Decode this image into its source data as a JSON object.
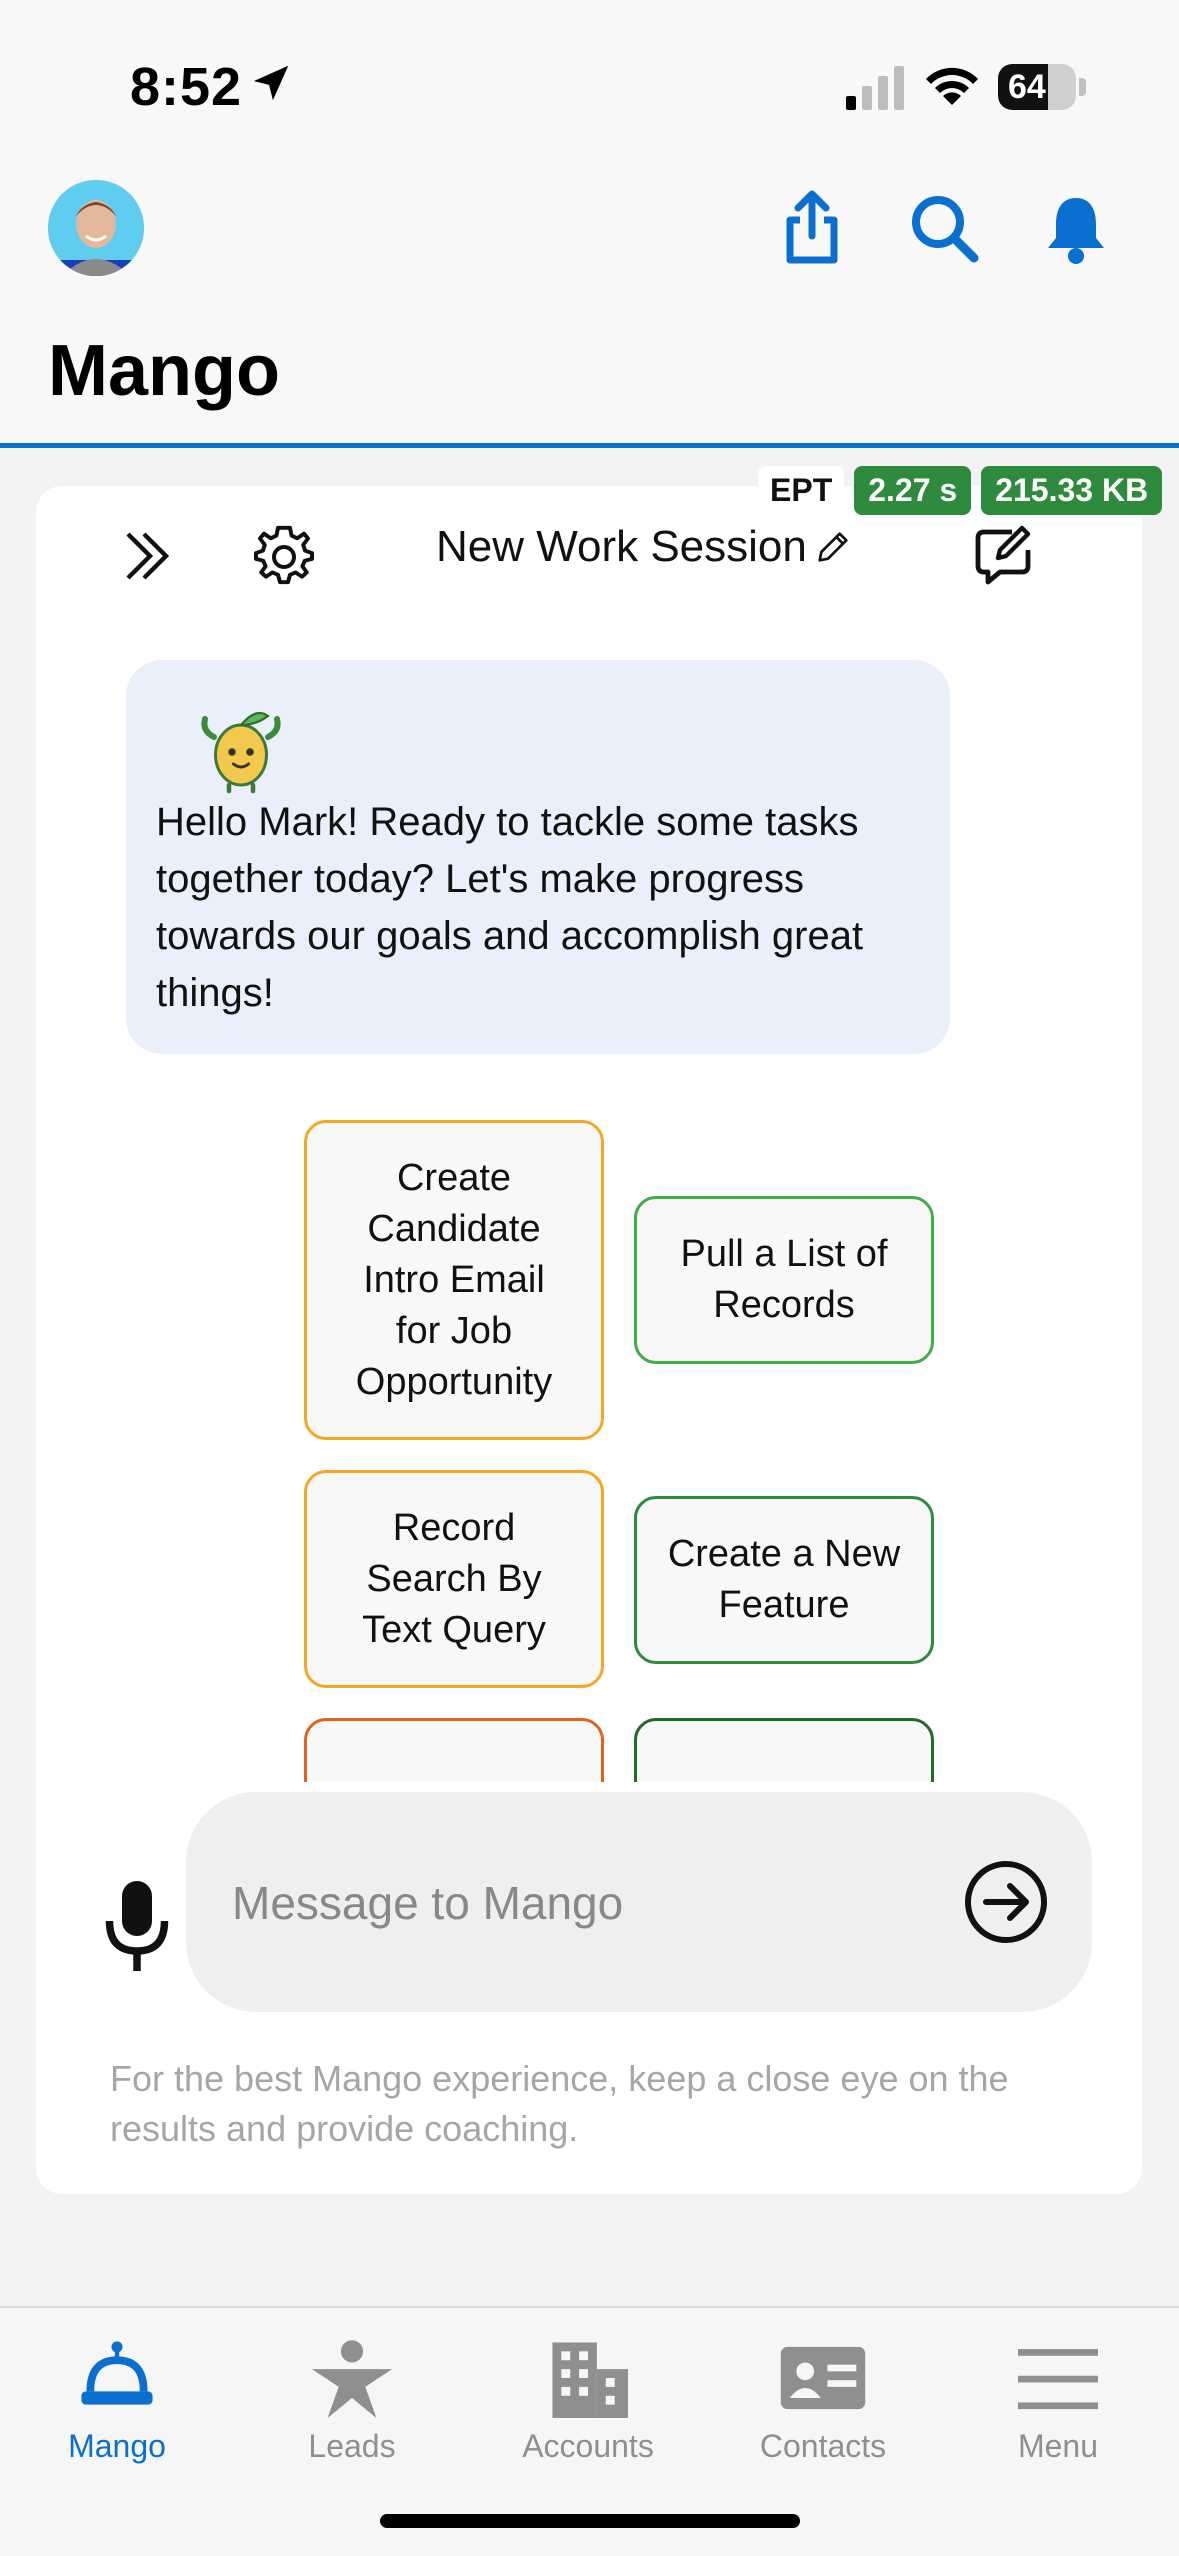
{
  "status_bar": {
    "time": "8:52",
    "battery": "64",
    "battery_level": 0.64
  },
  "header": {
    "title": "Mango"
  },
  "metrics": {
    "label": "EPT",
    "time": "2.27 s",
    "size": "215.33 KB"
  },
  "session": {
    "title": "New Work Session"
  },
  "greeting": {
    "text": "Hello Mark! Ready to tackle some tasks together today? Let's make progress towards our goals and accomplish great things!"
  },
  "prompts": [
    {
      "label": "Create Candidate Intro Email for Job Opportunity",
      "color": "#f5a623"
    },
    {
      "label": "Pull a List of Records",
      "color": "#3cb043"
    },
    {
      "label": "Record Search By Text Query",
      "color": "#f5a623"
    },
    {
      "label": "Create a New Feature",
      "color": "#2e8b3d"
    }
  ],
  "composer": {
    "placeholder": "Message to Mango"
  },
  "disclaimer": "For the best Mango experience, keep a close eye on the results and provide coaching.",
  "tabs": [
    {
      "label": "Mango",
      "icon": "mango-robot-icon",
      "active": true
    },
    {
      "label": "Leads",
      "icon": "star-person-icon"
    },
    {
      "label": "Accounts",
      "icon": "building-icon"
    },
    {
      "label": "Contacts",
      "icon": "contact-card-icon"
    },
    {
      "label": "Menu",
      "icon": "hamburger-menu-icon"
    }
  ],
  "colors": {
    "accent": "#0b6fd0",
    "badge_green": "#2e8b3d",
    "bubble_bg": "#e9f0fb"
  }
}
